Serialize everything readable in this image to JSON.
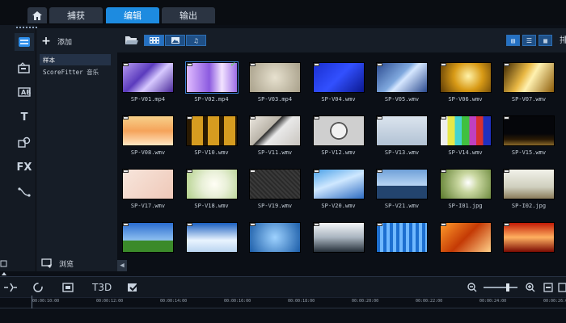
{
  "tabs": {
    "capture": "捕获",
    "edit": "编辑",
    "share": "输出"
  },
  "library": {
    "add_label": "添加",
    "tree": [
      "样本",
      "ScoreFitter 音乐"
    ],
    "browse_label": "浏览"
  },
  "toolbar": {
    "sort_label": "排"
  },
  "toolstrip": {
    "title_tool": "T",
    "fx_tool": "FX"
  },
  "timeline": {
    "title_icon_label": "T3D",
    "ticks": [
      "00:00:10:00",
      "00:00:12:00",
      "00:00:14:00",
      "00:00:16:00",
      "00:00:18:00",
      "00:00:20:00",
      "00:00:22:00",
      "00:00:24:00",
      "00:00:26:00"
    ]
  },
  "media": [
    {
      "name": "SP-V01.mp4"
    },
    {
      "name": "SP-V02.mp4"
    },
    {
      "name": "SP-V03.mp4"
    },
    {
      "name": "SP-V04.wmv"
    },
    {
      "name": "SP-V05.wmv"
    },
    {
      "name": "SP-V06.wmv"
    },
    {
      "name": "SP-V07.wmv"
    },
    {
      "name": "SP-V08.wmv"
    },
    {
      "name": "SP-V10.wmv"
    },
    {
      "name": "SP-V11.wmv"
    },
    {
      "name": "SP-V12.wmv"
    },
    {
      "name": "SP-V13.wmv"
    },
    {
      "name": "SP-V14.wmv"
    },
    {
      "name": "SP-V15.wmv"
    },
    {
      "name": "SP-V17.wmv"
    },
    {
      "name": "SP-V18.wmv"
    },
    {
      "name": "SP-V19.wmv"
    },
    {
      "name": "SP-V20.wmv"
    },
    {
      "name": "SP-V21.wmv"
    },
    {
      "name": "SP-I01.jpg"
    },
    {
      "name": "SP-I02.jpg"
    },
    {
      "name": ""
    },
    {
      "name": ""
    },
    {
      "name": ""
    },
    {
      "name": ""
    },
    {
      "name": ""
    },
    {
      "name": ""
    },
    {
      "name": ""
    }
  ],
  "icons": {
    "home": "home-icon",
    "plus": "plus-icon",
    "folder": "folder-open-icon",
    "zoom_out": "zoom-out-icon",
    "zoom_in": "zoom-in-icon"
  }
}
